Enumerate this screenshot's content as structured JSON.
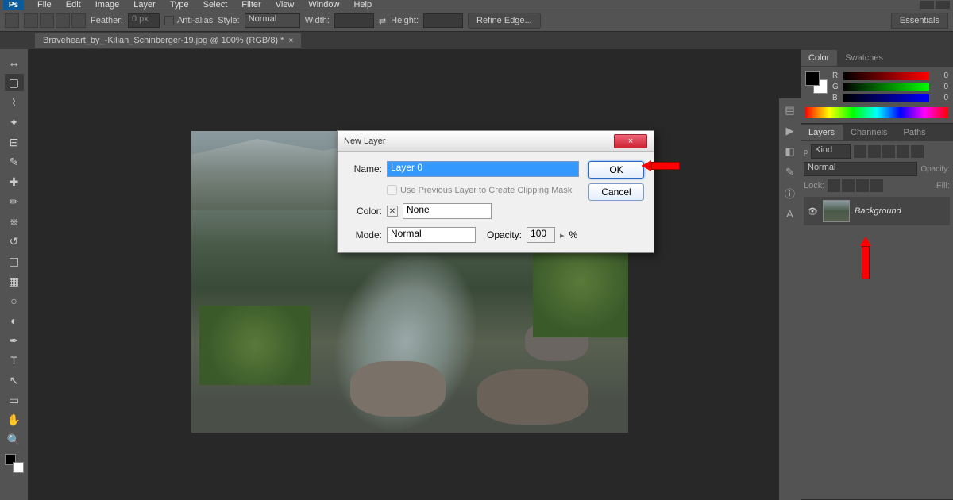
{
  "app": {
    "logo": "Ps"
  },
  "menu": [
    "File",
    "Edit",
    "Image",
    "Layer",
    "Type",
    "Select",
    "Filter",
    "View",
    "Window",
    "Help"
  ],
  "options": {
    "feather_label": "Feather:",
    "feather_value": "0 px",
    "antialias": "Anti-alias",
    "style_label": "Style:",
    "style_value": "Normal",
    "width_label": "Width:",
    "height_label": "Height:",
    "refine": "Refine Edge...",
    "essentials": "Essentials"
  },
  "doctab": {
    "title": "Braveheart_by_-Kilian_Schinberger-19.jpg @ 100% (RGB/8) *",
    "close": "×"
  },
  "panels": {
    "color_tab": "Color",
    "swatches_tab": "Swatches",
    "r": "R",
    "g": "G",
    "b": "B",
    "r_val": "0",
    "g_val": "0",
    "b_val": "0",
    "layers_tab": "Layers",
    "channels_tab": "Channels",
    "paths_tab": "Paths",
    "kind_label": "Kind",
    "blend": "Normal",
    "opacity_label": "Opacity:",
    "lock_label": "Lock:",
    "fill_label": "Fill:",
    "bg_layer": "Background"
  },
  "dialog": {
    "title": "New Layer",
    "name_label": "Name:",
    "name_value": "Layer 0",
    "clip_label": "Use Previous Layer to Create Clipping Mask",
    "color_label": "Color:",
    "color_value": "None",
    "color_x": "✕",
    "mode_label": "Mode:",
    "mode_value": "Normal",
    "opacity_label": "Opacity:",
    "opacity_value": "100",
    "opacity_suffix": "%",
    "ok": "OK",
    "cancel": "Cancel",
    "close": "×"
  },
  "icons": {
    "move": "↔",
    "marquee": "▢",
    "lasso": "⌇",
    "wand": "✦",
    "crop": "⊟",
    "eyedrop": "✎",
    "heal": "✚",
    "brush": "✏",
    "stamp": "⎈",
    "history": "↺",
    "eraser": "◫",
    "gradient": "▦",
    "blur": "○",
    "dodge": "◐",
    "pen": "✒",
    "type": "T",
    "path": "↖",
    "shape": "▭",
    "hand": "✋",
    "zoom": "🔍",
    "eye": "👁"
  }
}
